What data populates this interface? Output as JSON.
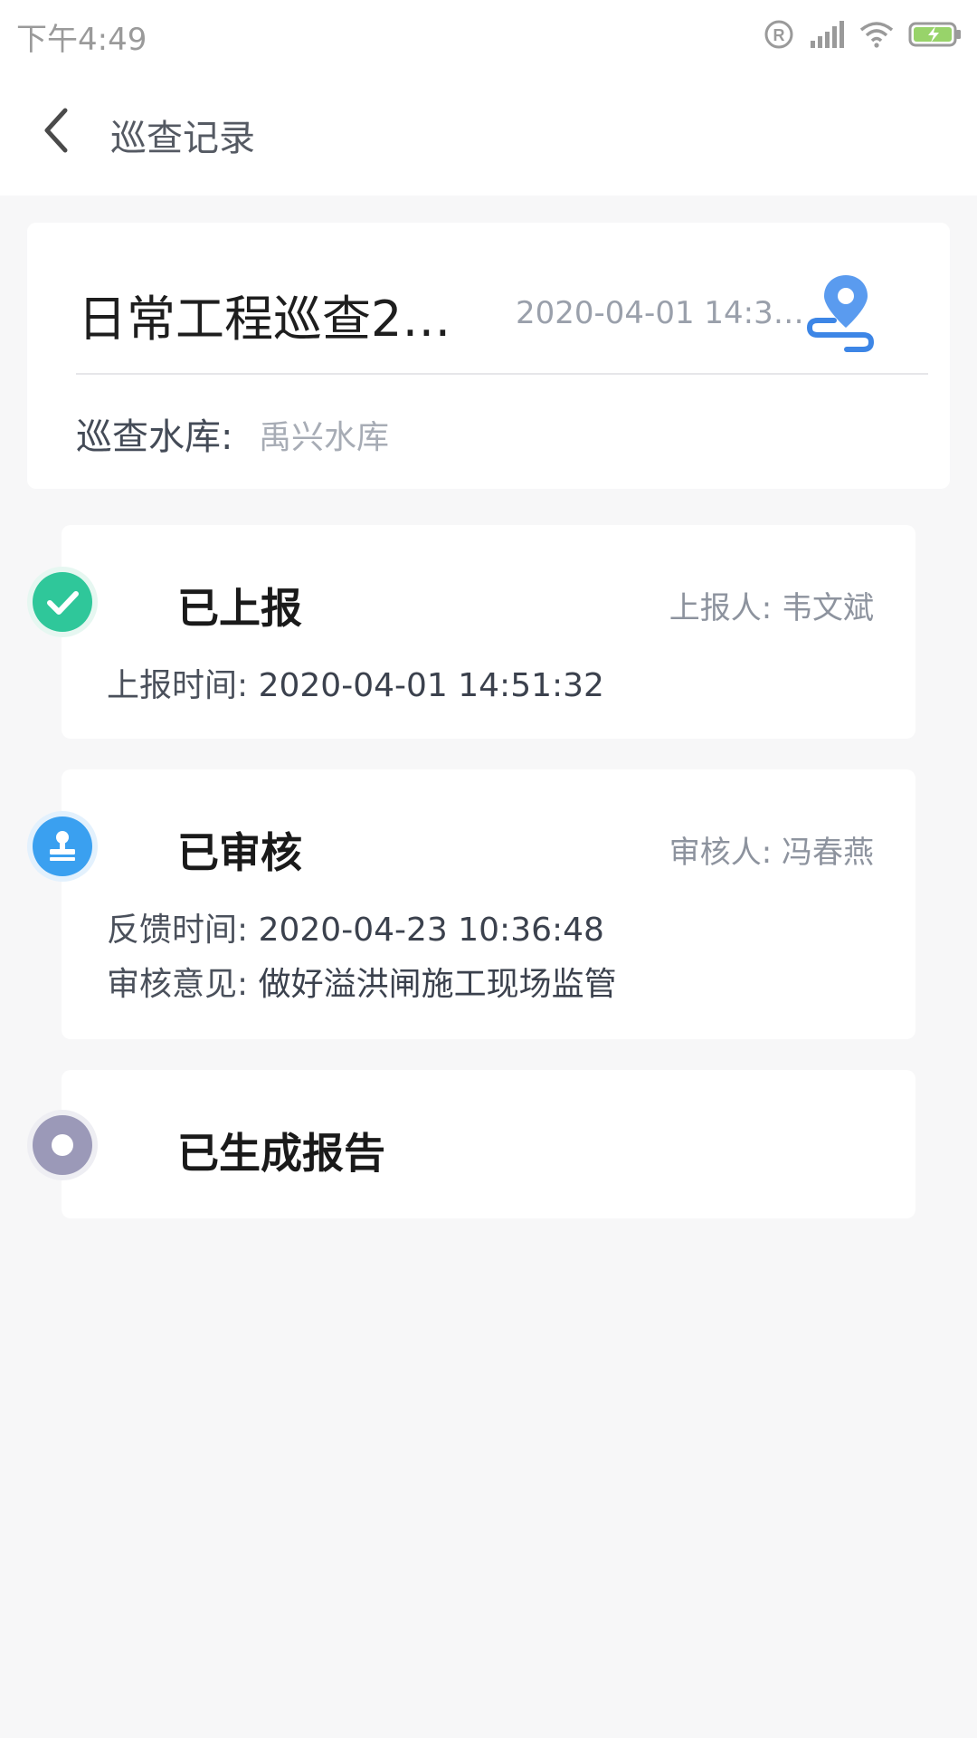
{
  "status_bar": {
    "time": "下午4:49",
    "icons": [
      "registered-icon",
      "signal-icon",
      "wifi-icon",
      "battery-charging-icon"
    ]
  },
  "header": {
    "title": "巡查记录"
  },
  "record": {
    "name": "日常工程巡查20…",
    "date": "2020-04-01 14:3…",
    "reservoir_label": "巡查水库:",
    "reservoir_value": "禹兴水库"
  },
  "timeline": [
    {
      "title": "已上报",
      "person_label": "上报人:",
      "person_value": "韦文斌",
      "lines": [
        {
          "label": "上报时间:",
          "value": "2020-04-01 14:51:32"
        }
      ],
      "icon": "check-icon",
      "color": "#2fc79a"
    },
    {
      "title": "已审核",
      "person_label": "审核人:",
      "person_value": "冯春燕",
      "lines": [
        {
          "label": "反馈时间:",
          "value": "2020-04-23 10:36:48"
        },
        {
          "label": "审核意见:",
          "value": "做好溢洪闸施工现场监管"
        }
      ],
      "icon": "stamp-icon",
      "color": "#3aa0f0"
    },
    {
      "title": "已生成报告",
      "icon": "pending-dot-icon",
      "color": "#9b99b8"
    }
  ],
  "colors": {
    "accent_blue": "#4a90e2",
    "background": "#f7f7f8"
  }
}
